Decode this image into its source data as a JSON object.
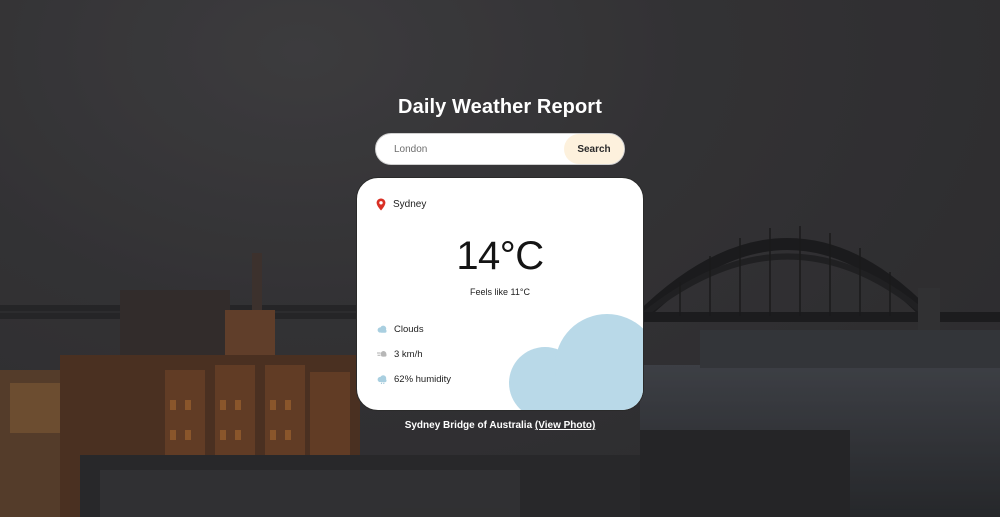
{
  "app": {
    "title": "Daily Weather Report"
  },
  "search": {
    "placeholder": "London",
    "value": "",
    "button_label": "Search"
  },
  "weather": {
    "location": "Sydney",
    "temperature": "14°C",
    "feels_like": "Feels like 11°C",
    "conditions": "Clouds",
    "wind": "3 km/h",
    "humidity": "62% humidity"
  },
  "credit": {
    "text": "Sydney Bridge of Australia",
    "link_label": "(View Photo)"
  },
  "colors": {
    "accent_cloud": "#b9d9e8",
    "pin": "#d93025",
    "button_bg": "#fdf1dd",
    "background": "#3a3a3c"
  },
  "icons": {
    "location": "map-pin-icon",
    "conditions": "cloud-icon",
    "wind": "wind-icon",
    "humidity": "humidity-cloud-icon"
  }
}
